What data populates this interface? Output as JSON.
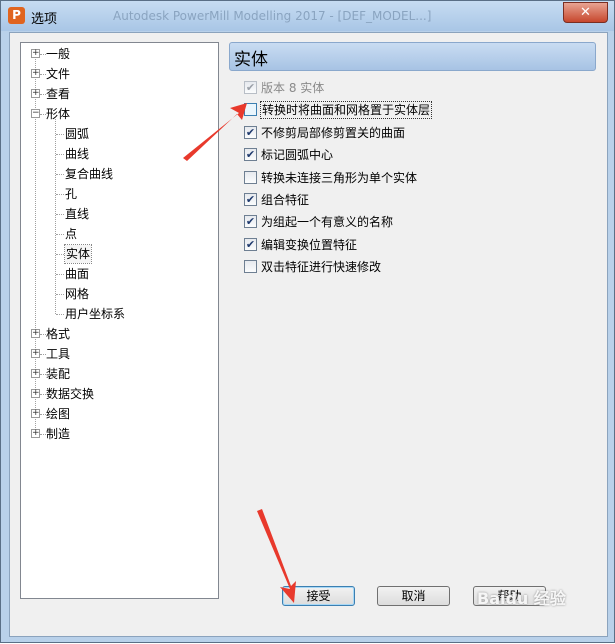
{
  "window": {
    "title": "选项",
    "app_icon_letter": "P",
    "background_title": "Autodesk PowerMill Modelling 2017 - [DEF_MODEL...]",
    "close_glyph": "✕"
  },
  "tree": {
    "expander_plus": "+",
    "expander_minus": "−",
    "items": [
      {
        "label": "一般",
        "expanded": false
      },
      {
        "label": "文件",
        "expanded": false
      },
      {
        "label": "查看",
        "expanded": false
      },
      {
        "label": "形体",
        "expanded": true
      },
      {
        "label": "圆弧",
        "child": true
      },
      {
        "label": "曲线",
        "child": true
      },
      {
        "label": "复合曲线",
        "child": true
      },
      {
        "label": "孔",
        "child": true
      },
      {
        "label": "直线",
        "child": true
      },
      {
        "label": "点",
        "child": true
      },
      {
        "label": "实体",
        "child": true,
        "selected": true
      },
      {
        "label": "曲面",
        "child": true
      },
      {
        "label": "网格",
        "child": true
      },
      {
        "label": "用户坐标系",
        "child": true
      },
      {
        "label": "格式",
        "expanded": false
      },
      {
        "label": "工具",
        "expanded": false
      },
      {
        "label": "装配",
        "expanded": false
      },
      {
        "label": "数据交换",
        "expanded": false
      },
      {
        "label": "绘图",
        "expanded": false
      },
      {
        "label": "制造",
        "expanded": false
      }
    ]
  },
  "panel": {
    "title": "实体",
    "check_glyph": "✔",
    "options": [
      {
        "label": "版本 8 实体",
        "checked": true,
        "disabled": true
      },
      {
        "label": "转换时将曲面和网格置于实体层",
        "checked": false,
        "focused": true
      },
      {
        "label": "不修剪局部修剪置关的曲面",
        "checked": true
      },
      {
        "label": "标记圆弧中心",
        "checked": true
      },
      {
        "label": "转换未连接三角形为单个实体",
        "checked": false
      },
      {
        "label": "组合特征",
        "checked": true
      },
      {
        "label": "为组起一个有意义的名称",
        "checked": true
      },
      {
        "label": "编辑变换位置特征",
        "checked": true
      },
      {
        "label": "双击特征进行快速修改",
        "checked": false
      }
    ]
  },
  "buttons": {
    "accept": "接受",
    "cancel": "取消",
    "help": "帮助"
  },
  "watermark": "Baidu 经验",
  "colors": {
    "annotation_arrow": "#e8392c",
    "header_gradient_top": "#c9dcf2",
    "header_gradient_bottom": "#a7c3e4"
  }
}
